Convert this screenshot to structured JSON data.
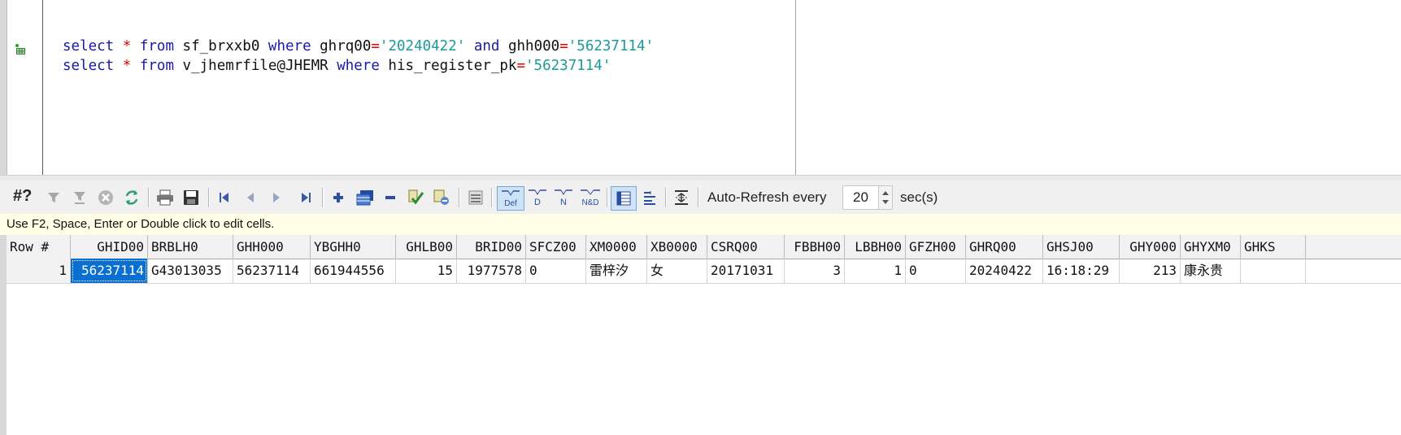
{
  "editor": {
    "lines": [
      [
        {
          "t": "select",
          "c": "kw"
        },
        {
          "t": " ",
          "c": ""
        },
        {
          "t": "*",
          "c": "op"
        },
        {
          "t": " ",
          "c": ""
        },
        {
          "t": "from",
          "c": "kw"
        },
        {
          "t": " sf_brxxb0 ",
          "c": ""
        },
        {
          "t": "where",
          "c": "kw"
        },
        {
          "t": " ghrq00",
          "c": ""
        },
        {
          "t": "=",
          "c": "op"
        },
        {
          "t": "'20240422'",
          "c": "str"
        },
        {
          "t": " ",
          "c": ""
        },
        {
          "t": "and",
          "c": "kw"
        },
        {
          "t": " ghh000",
          "c": ""
        },
        {
          "t": "=",
          "c": "op"
        },
        {
          "t": "'56237114'",
          "c": "str"
        }
      ],
      [
        {
          "t": "select",
          "c": "kw"
        },
        {
          "t": " ",
          "c": ""
        },
        {
          "t": "*",
          "c": "op"
        },
        {
          "t": " ",
          "c": ""
        },
        {
          "t": "from",
          "c": "kw"
        },
        {
          "t": " v_jhemrfile@JHEMR ",
          "c": ""
        },
        {
          "t": "where",
          "c": "kw"
        },
        {
          "t": " his_register_pk",
          "c": ""
        },
        {
          "t": "=",
          "c": "op"
        },
        {
          "t": "'56237114'",
          "c": "str"
        }
      ]
    ]
  },
  "toolbar": {
    "hash_label": "#?",
    "auto_refresh_label": "Auto-Refresh every",
    "refresh_value": "20",
    "refresh_unit": "sec(s)"
  },
  "hint": {
    "text": "Use F2, Space, Enter or Double click to edit cells."
  },
  "grid": {
    "columns": [
      "Row #",
      "GHID00",
      "BRBLH0",
      "GHH000",
      "YBGHH0",
      "GHLB00",
      "BRID00",
      "SFCZ00",
      "XM0000",
      "XB0000",
      "CSRQ00",
      "FBBH00",
      "LBBH00",
      "GFZH00",
      "GHRQ00",
      "GHSJ00",
      "GHY000",
      "GHYXM0",
      "GHKS"
    ],
    "rows": [
      [
        "1",
        "56237114",
        "G43013035",
        "56237114",
        "661944556",
        "15",
        "1977578",
        "0",
        "雷梓汐",
        "女",
        "20171031",
        "3",
        "1",
        "0",
        "20240422",
        "16:18:29",
        "213",
        "康永贵",
        ""
      ]
    ]
  }
}
